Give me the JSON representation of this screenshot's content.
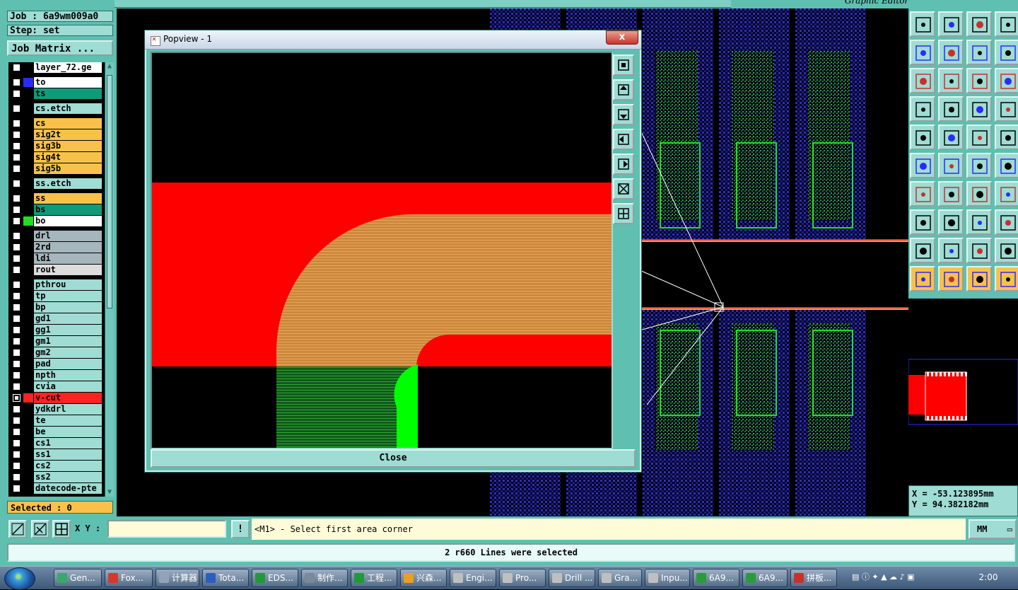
{
  "app": {
    "window_title": "Graphic Editor"
  },
  "job": {
    "job_label": "Job : 6a9wm009a0",
    "step_label": "Step: set",
    "matrix_button": "Job Matrix ..."
  },
  "layers": [
    {
      "name": "layer_72.ge",
      "color": "#ffffff",
      "sw": "#000000",
      "checked": false
    },
    {
      "name": "to",
      "color": "#ffffff",
      "sw": "#2a2aff",
      "checked": false
    },
    {
      "name": "ts",
      "color": "#0f9b7a",
      "sw": "#000000",
      "checked": false
    },
    {
      "name": "cs.etch",
      "color": "#9fdcd4",
      "sw": "#000000",
      "checked": false
    },
    {
      "name": "cs",
      "color": "#f8c24a",
      "sw": "#000000",
      "checked": false
    },
    {
      "name": "sig2t",
      "color": "#f8c24a",
      "sw": "#000000",
      "checked": false
    },
    {
      "name": "sig3b",
      "color": "#f8c24a",
      "sw": "#000000",
      "checked": false
    },
    {
      "name": "sig4t",
      "color": "#f8c24a",
      "sw": "#000000",
      "checked": false
    },
    {
      "name": "sig5b",
      "color": "#f8c24a",
      "sw": "#000000",
      "checked": false
    },
    {
      "name": "ss.etch",
      "color": "#9fdcd4",
      "sw": "#000000",
      "checked": false
    },
    {
      "name": "ss",
      "color": "#f8c24a",
      "sw": "#000000",
      "checked": false
    },
    {
      "name": "bs",
      "color": "#0f9b7a",
      "sw": "#000000",
      "checked": false
    },
    {
      "name": "bo",
      "color": "#ffffff",
      "sw": "#22dd22",
      "checked": false
    },
    {
      "name": "drl",
      "color": "#a6b6bd",
      "sw": "#000000",
      "checked": false
    },
    {
      "name": "2rd",
      "color": "#a6b6bd",
      "sw": "#000000",
      "checked": false
    },
    {
      "name": "ldi",
      "color": "#a6b6bd",
      "sw": "#000000",
      "checked": false
    },
    {
      "name": "rout",
      "color": "#dcdcdc",
      "sw": "#000000",
      "checked": false
    },
    {
      "name": "pthrou",
      "color": "#9fdcd4",
      "sw": "#000000",
      "checked": false
    },
    {
      "name": "tp",
      "color": "#9fdcd4",
      "sw": "#000000",
      "checked": false
    },
    {
      "name": "bp",
      "color": "#9fdcd4",
      "sw": "#000000",
      "checked": false
    },
    {
      "name": "gd1",
      "color": "#9fdcd4",
      "sw": "#000000",
      "checked": false
    },
    {
      "name": "gg1",
      "color": "#9fdcd4",
      "sw": "#000000",
      "checked": false
    },
    {
      "name": "gm1",
      "color": "#9fdcd4",
      "sw": "#000000",
      "checked": false
    },
    {
      "name": "gm2",
      "color": "#9fdcd4",
      "sw": "#000000",
      "checked": false
    },
    {
      "name": "pad",
      "color": "#9fdcd4",
      "sw": "#000000",
      "checked": false
    },
    {
      "name": "npth",
      "color": "#9fdcd4",
      "sw": "#000000",
      "checked": false
    },
    {
      "name": "cvia",
      "color": "#9fdcd4",
      "sw": "#000000",
      "checked": false
    },
    {
      "name": "v-cut",
      "color": "#ff2222",
      "sw": "#ff2222",
      "checked": true
    },
    {
      "name": "ydkdrl",
      "color": "#9fdcd4",
      "sw": "#000000",
      "checked": false
    },
    {
      "name": "te",
      "color": "#9fdcd4",
      "sw": "#000000",
      "checked": false
    },
    {
      "name": "be",
      "color": "#9fdcd4",
      "sw": "#000000",
      "checked": false
    },
    {
      "name": "cs1",
      "color": "#9fdcd4",
      "sw": "#000000",
      "checked": false
    },
    {
      "name": "ss1",
      "color": "#9fdcd4",
      "sw": "#000000",
      "checked": false
    },
    {
      "name": "cs2",
      "color": "#9fdcd4",
      "sw": "#000000",
      "checked": false
    },
    {
      "name": "ss2",
      "color": "#9fdcd4",
      "sw": "#000000",
      "checked": false
    },
    {
      "name": "datecode-pte",
      "color": "#9fdcd4",
      "sw": "#000000",
      "checked": false
    }
  ],
  "selected_label": "Selected : 0",
  "popview": {
    "title": "Popview - 1",
    "close_x": "x",
    "close_button": "Close"
  },
  "coords": {
    "x": "X = -53.123895mm",
    "y": "Y = 94.382182mm"
  },
  "command": {
    "xy_label": "X Y :",
    "xy_value": "",
    "excl": "!",
    "prompt": "<M1> - Select first area corner",
    "units": "MM"
  },
  "status": "2 r660 Lines were selected",
  "taskbar": {
    "tasks": [
      {
        "label": "Gen...",
        "icon": "#3aa86a"
      },
      {
        "label": "Fox...",
        "icon": "#d33a2a"
      },
      {
        "label": "计算器",
        "icon": "#8fa4b8"
      },
      {
        "label": "Tota...",
        "icon": "#2a5fbf"
      },
      {
        "label": "EDS...",
        "icon": "#1f9a3a"
      },
      {
        "label": "制作...",
        "icon": "#7a8a9a"
      },
      {
        "label": "工程...",
        "icon": "#1f9a3a"
      },
      {
        "label": "兴森...",
        "icon": "#e8a020"
      },
      {
        "label": "Engi...",
        "icon": "#bfbfbf"
      },
      {
        "label": "Pro...",
        "icon": "#bfbfbf"
      },
      {
        "label": "Drill ...",
        "icon": "#bfbfbf"
      },
      {
        "label": "Gra...",
        "icon": "#bfbfbf"
      },
      {
        "label": "Inpu...",
        "icon": "#bfbfbf"
      },
      {
        "label": "6A9...",
        "icon": "#2a9a3a"
      },
      {
        "label": "6A9...",
        "icon": "#2a9a3a"
      },
      {
        "label": "拼板...",
        "icon": "#c8302a"
      }
    ],
    "clock": "2:00"
  }
}
